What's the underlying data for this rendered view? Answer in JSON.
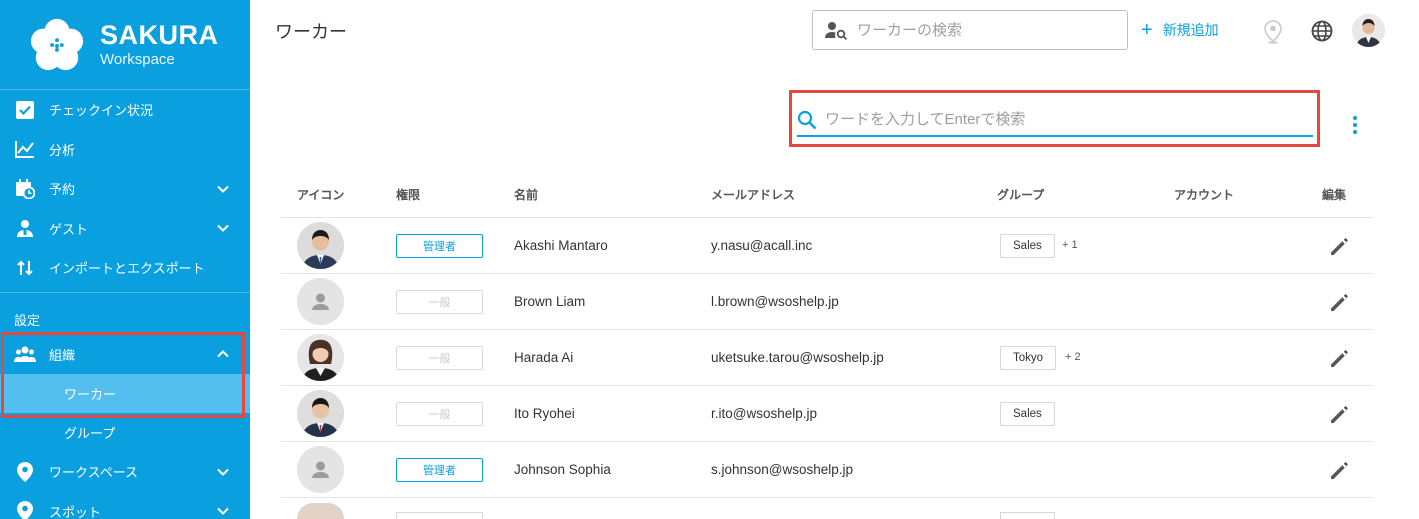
{
  "brand": {
    "name": "SAKURA",
    "subtitle": "Workspace"
  },
  "sidebar": {
    "items": [
      {
        "label": "チェックイン状況",
        "icon": "checkbox-icon"
      },
      {
        "label": "分析",
        "icon": "chart-icon"
      },
      {
        "label": "予約",
        "icon": "calendar-clock-icon"
      },
      {
        "label": "ゲスト",
        "icon": "guest-icon"
      },
      {
        "label": "インポートとエクスポート",
        "icon": "import-export-icon"
      }
    ],
    "section_label": "設定",
    "org": {
      "label": "組織",
      "icon": "people-icon"
    },
    "org_children": [
      {
        "label": "ワーカー"
      },
      {
        "label": "グループ"
      }
    ],
    "more_items": [
      {
        "label": "ワークスペース",
        "icon": "location-pin-icon"
      },
      {
        "label": "スポット",
        "icon": "location-pin-icon"
      }
    ]
  },
  "header": {
    "title": "ワーカー",
    "search_placeholder": "ワーカーの検索",
    "add_label": "新規追加"
  },
  "keyword_search": {
    "placeholder": "ワードを入力してEnterで検索"
  },
  "table": {
    "headers": [
      "アイコン",
      "権限",
      "名前",
      "メールアドレス",
      "グループ",
      "アカウント",
      "編集"
    ],
    "rows": [
      {
        "role": "管理者",
        "name": "Akashi Mantaro",
        "email": "y.nasu@acall.inc",
        "group": "Sales",
        "group_more": "+ 1",
        "avatar": "photo"
      },
      {
        "role": "一般",
        "name": "Brown Liam",
        "email": "l.brown@wsoshelp.jp",
        "group": "",
        "group_more": "",
        "avatar": "placeholder"
      },
      {
        "role": "一般",
        "name": "Harada Ai",
        "email": "uketsuke.tarou@wsoshelp.jp",
        "group": "Tokyo",
        "group_more": "+ 2",
        "avatar": "photo"
      },
      {
        "role": "一般",
        "name": "Ito Ryohei",
        "email": "r.ito@wsoshelp.jp",
        "group": "Sales",
        "group_more": "",
        "avatar": "photo"
      },
      {
        "role": "管理者",
        "name": "Johnson Sophia",
        "email": "s.johnson@wsoshelp.jp",
        "group": "",
        "group_more": "",
        "avatar": "placeholder"
      }
    ]
  },
  "colors": {
    "sidebar": "#0aa0e0",
    "accent": "#0aa0e0",
    "highlight": "#e5483e",
    "active_sub": "#52bfee"
  }
}
